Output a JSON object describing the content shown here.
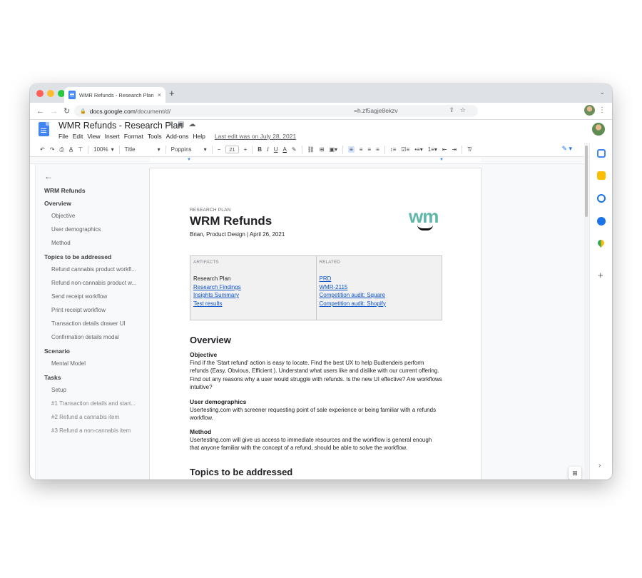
{
  "browser": {
    "tab_title": "WMR Refunds - Research Plan",
    "tab_close": "×",
    "new_tab": "+",
    "url_host": "docs.google.com",
    "url_path": "/document/d/",
    "url_tail": "=h.zf5agje8ekzv"
  },
  "doc": {
    "title": "WMR Refunds - Research Plan",
    "menu": [
      "File",
      "Edit",
      "View",
      "Insert",
      "Format",
      "Tools",
      "Add-ons",
      "Help"
    ],
    "last_edit": "Last edit was on July 28, 2021"
  },
  "toolbar": {
    "zoom": "100%",
    "style": "Title",
    "font": "Poppins",
    "font_size": "21"
  },
  "outline": {
    "title": "WRM Refunds",
    "sections": [
      {
        "heading": "Overview",
        "items": [
          "Objective",
          "User demographics",
          "Method"
        ]
      },
      {
        "heading": "Topics to be addressed",
        "items": [
          "Refund cannabis product workfl...",
          "Refund non-cannabis product w...",
          "Send receipt workflow",
          "Print receipt workflow",
          "Transaction details drawer UI",
          "Confirmation details modal"
        ]
      },
      {
        "heading": "Scenario",
        "items": [
          "Mental Model"
        ]
      },
      {
        "heading": "Tasks",
        "items": [
          "Setup",
          "#1 Transaction details and start...",
          "#2 Refund a cannabis item",
          "#3 Refund a non-cannabis item"
        ]
      }
    ]
  },
  "page": {
    "kicker": "RESEARCH PLAN",
    "title": "WRM Refunds",
    "byline": "Brian, Product Design | April 26, 2021",
    "logo_text": "wm",
    "artifacts_header": "ARTIFACTS",
    "related_header": "RELATED",
    "artifacts": [
      {
        "text": "Research Plan",
        "link": false
      },
      {
        "text": "Research Findings",
        "link": true
      },
      {
        "text": "Insights Summary",
        "link": true
      },
      {
        "text": "Test results",
        "link": true
      }
    ],
    "related": [
      "PRD",
      "WMR-2115",
      "Competition audit: Square",
      "Competition audit: Shopify"
    ],
    "overview_heading": "Overview",
    "objective_heading": "Objective",
    "objective_text": "Find if the 'Start refund' action is easy to locate. Find the best UX to help Budtenders perform refunds (Easy, Obvious, Efficient ). Understand what users like and dislike with our current offering. Find out any reasons why a user would struggle with refunds. Is the new UI effective? Are workflows intuitive?",
    "demographics_heading": "User demographics",
    "demographics_text": "Usertesting.com with screener requesting point of sale experience or being familiar with a refunds workflow.",
    "method_heading": "Method",
    "method_text": "Usertesting.com will give us access to immediate resources and the workflow is general enough that anyone familiar with the concept of a refund, should be able to solve the workflow.",
    "topics_heading": "Topics to be addressed"
  },
  "colors": {
    "docs_blue": "#4285f4",
    "link": "#1155cc",
    "logo_teal": "#5fb7a9"
  }
}
